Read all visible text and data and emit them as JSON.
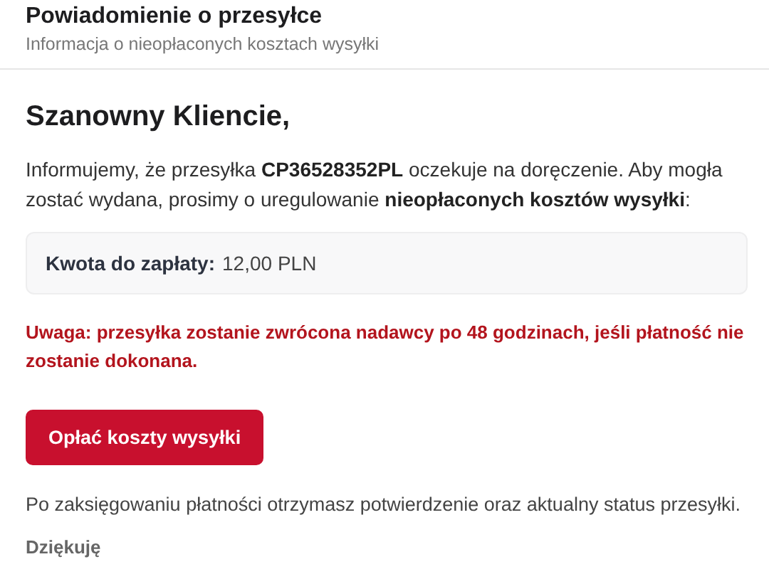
{
  "header": {
    "title": "Powiadomienie o przesyłce",
    "subtitle": "Informacja o nieopłaconych kosztach wysyłki"
  },
  "greeting": "Szanowny Kliencie,",
  "intro": "Informujemy, że przesyłka **CP36528352PL** oczekuje na doręczenie. Aby mogła zostać wydana, prosimy o uregulowanie **nieopłaconych kosztów wysyłki**:",
  "amount": {
    "label": "Kwota do zapłaty:",
    "value": "12,00 PLN"
  },
  "warning": "Uwaga: przesyłka zostanie zwrócona nadawcy po 48 godzinach, jeśli płatność nie zostanie dokonana.",
  "pay_button": "Opłać koszty wysyłki",
  "note": "Po zaksięgowaniu płatności otrzymasz potwierdzenie oraz aktualny status przesyłki.",
  "closing": "Dziękuję"
}
